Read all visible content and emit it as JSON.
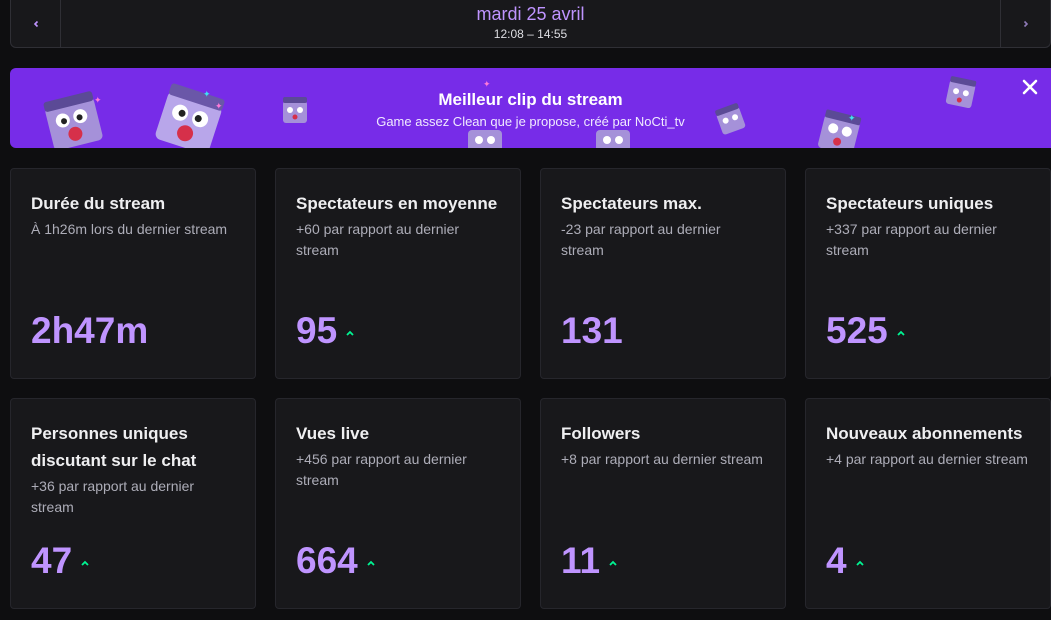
{
  "date_nav": {
    "date": "mardi 25 avril",
    "time_range": "12:08 – 14:55",
    "prev_icon": "chevron-left-icon",
    "next_icon": "chevron-right-icon"
  },
  "banner": {
    "title": "Meilleur clip du stream",
    "subtitle": "Game assez Clean que je propose, créé par NoCti_tv",
    "close_icon": "close-icon",
    "background": "#772ce8"
  },
  "colors": {
    "accent": "#bf94ff",
    "trend_up": "#00f593",
    "card_bg": "#18181b",
    "page_bg": "#0e0e10"
  },
  "stats": [
    {
      "title": "Durée du stream",
      "subtitle": "À 1h26m lors du dernier stream",
      "value": "2h47m",
      "trend": "none"
    },
    {
      "title": "Spectateurs en moyenne",
      "subtitle": "+60 par rapport au dernier stream",
      "value": "95",
      "trend": "up"
    },
    {
      "title": "Spectateurs max.",
      "subtitle": "-23 par rapport au dernier stream",
      "value": "131",
      "trend": "none"
    },
    {
      "title": "Spectateurs uniques",
      "subtitle": "+337 par rapport au dernier stream",
      "value": "525",
      "trend": "up"
    },
    {
      "title": "Personnes uniques discutant sur le chat",
      "subtitle": "+36 par rapport au dernier stream",
      "value": "47",
      "trend": "up"
    },
    {
      "title": "Vues live",
      "subtitle": "+456 par rapport au dernier stream",
      "value": "664",
      "trend": "up"
    },
    {
      "title": "Followers",
      "subtitle": "+8 par rapport au dernier stream",
      "value": "11",
      "trend": "up"
    },
    {
      "title": "Nouveaux abonnements",
      "subtitle": "+4 par rapport au dernier stream",
      "value": "4",
      "trend": "up"
    }
  ]
}
